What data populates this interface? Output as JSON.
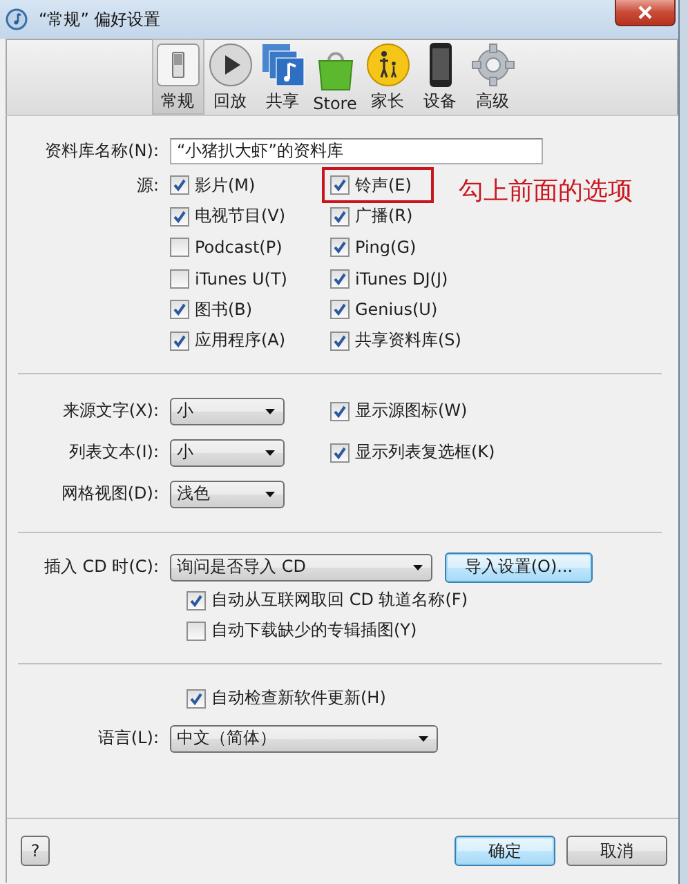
{
  "window": {
    "title": "“常规” 偏好设置"
  },
  "toolbar": [
    {
      "kind": "general",
      "label": "常规",
      "selected": true
    },
    {
      "kind": "playback",
      "label": "回放",
      "selected": false
    },
    {
      "kind": "sharing",
      "label": "共享",
      "selected": false
    },
    {
      "kind": "store",
      "label": "Store",
      "selected": false
    },
    {
      "kind": "parental",
      "label": "家长",
      "selected": false
    },
    {
      "kind": "devices",
      "label": "设备",
      "selected": false
    },
    {
      "kind": "advanced",
      "label": "高级",
      "selected": false
    }
  ],
  "library_name": {
    "label": "资料库名称(N):",
    "value": "“小猪扒大虾”的资料库"
  },
  "sources": {
    "label": "源:",
    "items": [
      {
        "label": "影片(M)",
        "checked": true,
        "highlighted": false
      },
      {
        "label": "铃声(E)",
        "checked": true,
        "highlighted": true
      },
      {
        "label": "电视节目(V)",
        "checked": true,
        "highlighted": false
      },
      {
        "label": "广播(R)",
        "checked": true,
        "highlighted": false
      },
      {
        "label": "Podcast(P)",
        "checked": false,
        "highlighted": false
      },
      {
        "label": "Ping(G)",
        "checked": true,
        "highlighted": false
      },
      {
        "label": "iTunes U(T)",
        "checked": false,
        "highlighted": false
      },
      {
        "label": "iTunes DJ(J)",
        "checked": true,
        "highlighted": false
      },
      {
        "label": "图书(B)",
        "checked": true,
        "highlighted": false
      },
      {
        "label": "Genius(U)",
        "checked": true,
        "highlighted": false
      },
      {
        "label": "应用程序(A)",
        "checked": true,
        "highlighted": false
      },
      {
        "label": "共享资料库(S)",
        "checked": true,
        "highlighted": false
      }
    ]
  },
  "annotation": {
    "text": "勾上前面的选项"
  },
  "display": [
    {
      "label": "来源文字(X):",
      "value": "小",
      "option": {
        "label": "显示源图标(W)",
        "checked": true
      }
    },
    {
      "label": "列表文本(I):",
      "value": "小",
      "option": {
        "label": "显示列表复选框(K)",
        "checked": true
      }
    },
    {
      "label": "网格视图(D):",
      "value": "浅色"
    }
  ],
  "cd": {
    "label": "插入 CD 时(C):",
    "value": "询问是否导入 CD",
    "button": "导入设置(O)...",
    "options": [
      {
        "label": "自动从互联网取回 CD 轨道名称(F)",
        "checked": true
      },
      {
        "label": "自动下载缺少的专辑插图(Y)",
        "checked": false
      }
    ]
  },
  "updates": {
    "label": "自动检查新软件更新(H)",
    "checked": true
  },
  "language": {
    "label": "语言(L):",
    "value": "中文（简体）"
  },
  "footer": {
    "help": "?",
    "ok": "确定",
    "cancel": "取消"
  }
}
